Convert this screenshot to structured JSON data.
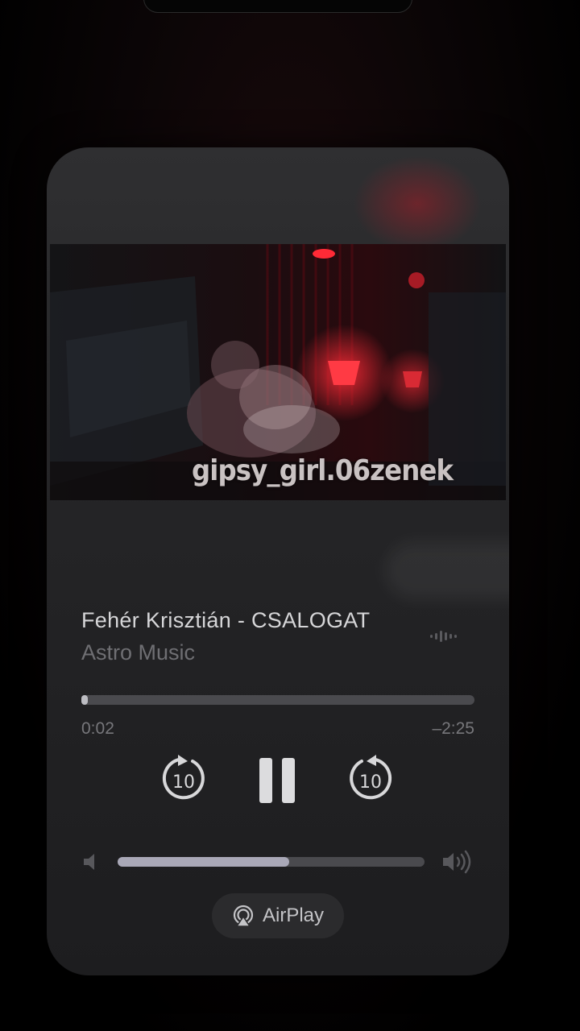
{
  "now_playing": {
    "title": "Fehér Krisztián - CSALOGAT",
    "artist": "Astro Music",
    "video_watermark": "gipsy_girl.06zenek",
    "elapsed": "0:02",
    "remaining": "–2:25",
    "progress_fraction": 0.015,
    "volume_fraction": 0.56
  },
  "controls": {
    "skip_back_seconds": "10",
    "skip_forward_seconds": "10",
    "airplay_label": "AirPlay"
  },
  "icons": {
    "skip_back": "skip-back-10-icon",
    "pause": "pause-icon",
    "skip_forward": "skip-forward-10-icon",
    "volume_low": "speaker-low-icon",
    "volume_high": "speaker-high-icon",
    "airplay": "airplay-icon",
    "waveform": "waveform-icon"
  },
  "colors": {
    "accent_red": "#e0212e",
    "card": "#2a2a2c"
  }
}
